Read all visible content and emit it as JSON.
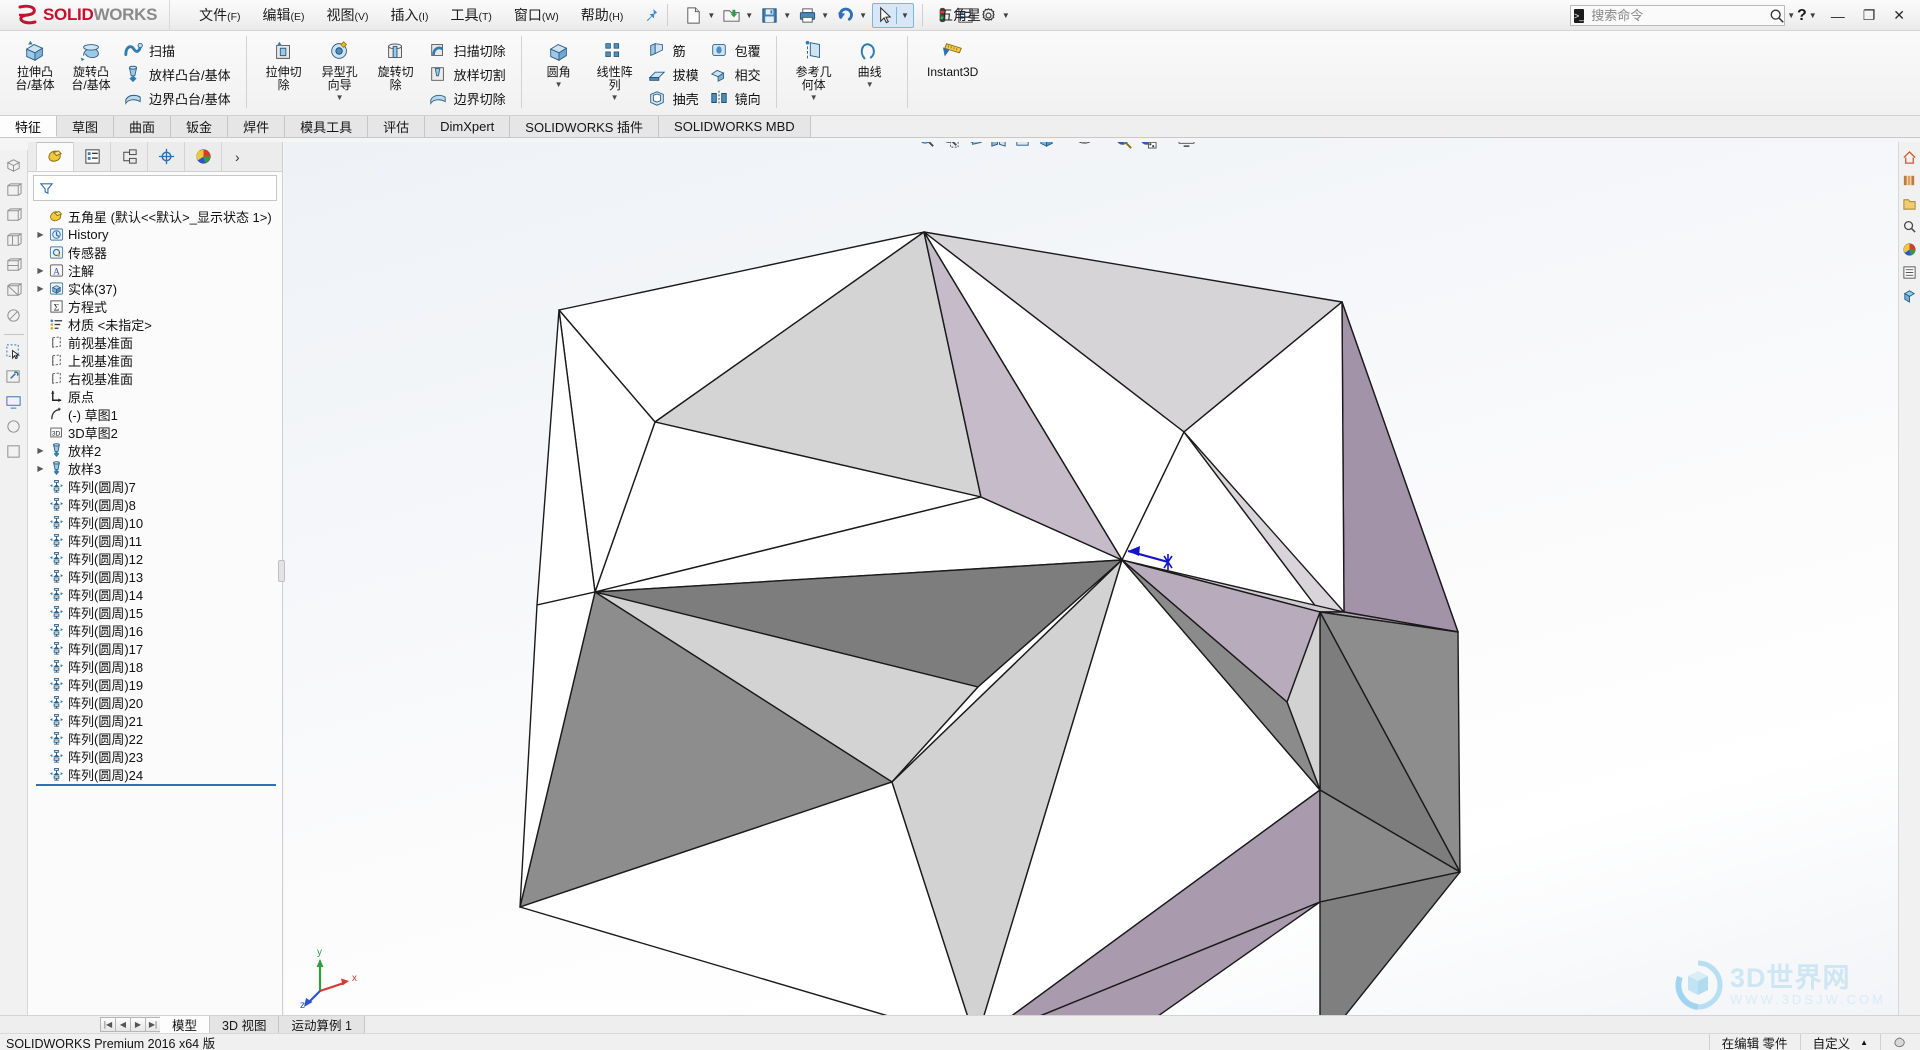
{
  "titlebar": {
    "brand_ds": "2S",
    "brand_solid": "SOLID",
    "brand_works": "WORKS",
    "document_title": "五角星",
    "menus": [
      {
        "label": "文件",
        "mnemonic": "(F)"
      },
      {
        "label": "编辑",
        "mnemonic": "(E)"
      },
      {
        "label": "视图",
        "mnemonic": "(V)"
      },
      {
        "label": "插入",
        "mnemonic": "(I)"
      },
      {
        "label": "工具",
        "mnemonic": "(T)"
      },
      {
        "label": "窗口",
        "mnemonic": "(W)"
      },
      {
        "label": "帮助",
        "mnemonic": "(H)"
      }
    ],
    "pin_icon": "pushpin-icon",
    "quick_tools": [
      {
        "name": "new-document-button",
        "icon": "new-file-icon",
        "has_caret": true
      },
      {
        "name": "open-document-button",
        "icon": "open-folder-icon",
        "has_caret": true
      },
      {
        "name": "save-button",
        "icon": "floppy-disk-icon",
        "has_caret": true
      },
      {
        "name": "print-button",
        "icon": "printer-icon",
        "has_caret": true
      },
      {
        "name": "undo-button",
        "icon": "undo-arrow-icon",
        "has_caret": true
      },
      {
        "name": "select-button",
        "icon": "cursor-arrow-icon",
        "has_caret": true,
        "selected": true
      },
      {
        "name": "rebuild-button",
        "icon": "traffic-light-icon",
        "has_caret": false
      },
      {
        "name": "options-list-button",
        "icon": "list-options-icon",
        "has_caret": false
      },
      {
        "name": "settings-button",
        "icon": "gear-icon",
        "has_caret": true
      }
    ],
    "search": {
      "placeholder": "搜索命令",
      "value": "",
      "icon": "command-search-icon",
      "magnifier": "magnifier-icon"
    },
    "help_label": "?",
    "window_buttons": [
      {
        "name": "minimize-button",
        "glyph": "—"
      },
      {
        "name": "restore-button",
        "glyph": "❐"
      },
      {
        "name": "close-button",
        "glyph": "✕"
      }
    ]
  },
  "ribbon": {
    "groups": [
      {
        "name": "boss-base-group",
        "big": [
          {
            "label": "拉伸凸\n台/基体",
            "icon": "extrude-boss-icon"
          },
          {
            "label": "旋转凸\n台/基体",
            "icon": "revolve-boss-icon"
          }
        ],
        "small": [
          {
            "label": "扫描",
            "icon": "sweep-icon"
          },
          {
            "label": "放样凸台/基体",
            "icon": "loft-boss-icon"
          },
          {
            "label": "边界凸台/基体",
            "icon": "boundary-boss-icon"
          }
        ]
      },
      {
        "name": "cut-group",
        "big": [
          {
            "label": "拉伸切\n除",
            "icon": "extrude-cut-icon"
          },
          {
            "label": "异型孔\n向导",
            "icon": "hole-wizard-icon",
            "caret": true
          },
          {
            "label": "旋转切\n除",
            "icon": "revolve-cut-icon"
          }
        ],
        "small": [
          {
            "label": "扫描切除",
            "icon": "sweep-cut-icon"
          },
          {
            "label": "放样切割",
            "icon": "loft-cut-icon"
          },
          {
            "label": "边界切除",
            "icon": "boundary-cut-icon"
          }
        ]
      },
      {
        "name": "feature-group",
        "big": [
          {
            "label": "圆角",
            "icon": "fillet-icon",
            "caret": true
          },
          {
            "label": "线性阵\n列",
            "icon": "linear-pattern-icon",
            "caret": true
          }
        ],
        "small_a": [
          {
            "label": "筋",
            "icon": "rib-icon"
          },
          {
            "label": "拔模",
            "icon": "draft-icon"
          },
          {
            "label": "抽壳",
            "icon": "shell-icon"
          }
        ],
        "small_b": [
          {
            "label": "包覆",
            "icon": "wrap-icon"
          },
          {
            "label": "相交",
            "icon": "intersect-icon"
          },
          {
            "label": "镜向",
            "icon": "mirror-icon"
          }
        ]
      },
      {
        "name": "reference-group",
        "big": [
          {
            "label": "参考几\n何体",
            "icon": "reference-geometry-icon",
            "caret": true
          },
          {
            "label": "曲线",
            "icon": "curves-icon",
            "caret": true
          }
        ]
      },
      {
        "name": "instant3d-group",
        "big": [
          {
            "label": "Instant3D",
            "icon": "instant3d-icon"
          }
        ]
      }
    ]
  },
  "command_tabs": [
    {
      "label": "特征",
      "active": true
    },
    {
      "label": "草图",
      "active": false
    },
    {
      "label": "曲面",
      "active": false
    },
    {
      "label": "钣金",
      "active": false
    },
    {
      "label": "焊件",
      "active": false
    },
    {
      "label": "模具工具",
      "active": false
    },
    {
      "label": "评估",
      "active": false
    },
    {
      "label": "DimXpert",
      "active": false
    },
    {
      "label": "SOLIDWORKS 插件",
      "active": false
    },
    {
      "label": "SOLIDWORKS MBD",
      "active": false
    }
  ],
  "left_rail": [
    {
      "name": "rail-icon-1",
      "icon": "isometric-view-icon"
    },
    {
      "name": "rail-icon-2",
      "icon": "box-view-icon"
    },
    {
      "name": "rail-icon-3",
      "icon": "box-outline-icon"
    },
    {
      "name": "rail-icon-4",
      "icon": "box-front-icon"
    },
    {
      "name": "rail-icon-5",
      "icon": "box-side-icon"
    },
    {
      "name": "rail-icon-6",
      "icon": "box-top-icon"
    },
    {
      "name": "rail-icon-7",
      "icon": "box-section-icon"
    },
    {
      "name": "rail-icon-8",
      "icon": "new-sketch-cursor-icon"
    },
    {
      "name": "rail-icon-9",
      "icon": "wrench-sketch-icon"
    },
    {
      "name": "rail-icon-10",
      "icon": "display-monitor-icon"
    },
    {
      "name": "rail-icon-11",
      "icon": "appearance-icon"
    },
    {
      "name": "rail-icon-12",
      "icon": "scene-icon"
    }
  ],
  "feature_manager": {
    "tabs": [
      {
        "name": "feature-tree-tab",
        "icon": "feature-tree-icon",
        "active": true
      },
      {
        "name": "property-manager-tab",
        "icon": "property-list-icon",
        "active": false
      },
      {
        "name": "configuration-manager-tab",
        "icon": "configuration-icon",
        "active": false
      },
      {
        "name": "dimxpert-manager-tab",
        "icon": "dimxpert-target-icon",
        "active": false
      },
      {
        "name": "display-manager-tab",
        "icon": "display-sphere-icon",
        "active": false
      }
    ],
    "more_glyph": "›",
    "filter": {
      "icon": "filter-funnel-icon",
      "placeholder": "",
      "value": ""
    },
    "root": {
      "label": "五角星  (默认<<默认>_显示状态 1>)",
      "icon": "part-document-icon"
    },
    "items": [
      {
        "label": "History",
        "icon": "history-icon",
        "arrow": true,
        "indent": 1
      },
      {
        "label": "传感器",
        "icon": "sensor-icon",
        "arrow": false,
        "indent": 1
      },
      {
        "label": "注解",
        "icon": "annotations-icon",
        "arrow": true,
        "indent": 1
      },
      {
        "label": "实体(37)",
        "icon": "solid-bodies-icon",
        "arrow": true,
        "indent": 1
      },
      {
        "label": "方程式",
        "icon": "equations-icon",
        "arrow": false,
        "indent": 1
      },
      {
        "label": "材质 <未指定>",
        "icon": "material-icon",
        "arrow": false,
        "indent": 1
      },
      {
        "label": "前视基准面",
        "icon": "plane-icon",
        "arrow": false,
        "indent": 1
      },
      {
        "label": "上视基准面",
        "icon": "plane-icon",
        "arrow": false,
        "indent": 1
      },
      {
        "label": "右视基准面",
        "icon": "plane-icon",
        "arrow": false,
        "indent": 1
      },
      {
        "label": "原点",
        "icon": "origin-icon",
        "arrow": false,
        "indent": 1
      },
      {
        "label": "(-) 草图1",
        "icon": "sketch-icon",
        "arrow": false,
        "indent": 1
      },
      {
        "label": "3D草图2",
        "icon": "sketch3d-icon",
        "arrow": false,
        "indent": 1
      },
      {
        "label": "放样2",
        "icon": "loft-feature-icon",
        "arrow": true,
        "indent": 1
      },
      {
        "label": "放样3",
        "icon": "loft-feature-icon",
        "arrow": true,
        "indent": 1
      },
      {
        "label": "阵列(圆周)7",
        "icon": "circular-pattern-icon",
        "arrow": false,
        "indent": 1
      },
      {
        "label": "阵列(圆周)8",
        "icon": "circular-pattern-icon",
        "arrow": false,
        "indent": 1
      },
      {
        "label": "阵列(圆周)10",
        "icon": "circular-pattern-icon",
        "arrow": false,
        "indent": 1
      },
      {
        "label": "阵列(圆周)11",
        "icon": "circular-pattern-icon",
        "arrow": false,
        "indent": 1
      },
      {
        "label": "阵列(圆周)12",
        "icon": "circular-pattern-icon",
        "arrow": false,
        "indent": 1
      },
      {
        "label": "阵列(圆周)13",
        "icon": "circular-pattern-icon",
        "arrow": false,
        "indent": 1
      },
      {
        "label": "阵列(圆周)14",
        "icon": "circular-pattern-icon",
        "arrow": false,
        "indent": 1
      },
      {
        "label": "阵列(圆周)15",
        "icon": "circular-pattern-icon",
        "arrow": false,
        "indent": 1
      },
      {
        "label": "阵列(圆周)16",
        "icon": "circular-pattern-icon",
        "arrow": false,
        "indent": 1
      },
      {
        "label": "阵列(圆周)17",
        "icon": "circular-pattern-icon",
        "arrow": false,
        "indent": 1
      },
      {
        "label": "阵列(圆周)18",
        "icon": "circular-pattern-icon",
        "arrow": false,
        "indent": 1
      },
      {
        "label": "阵列(圆周)19",
        "icon": "circular-pattern-icon",
        "arrow": false,
        "indent": 1
      },
      {
        "label": "阵列(圆周)20",
        "icon": "circular-pattern-icon",
        "arrow": false,
        "indent": 1
      },
      {
        "label": "阵列(圆周)21",
        "icon": "circular-pattern-icon",
        "arrow": false,
        "indent": 1
      },
      {
        "label": "阵列(圆周)22",
        "icon": "circular-pattern-icon",
        "arrow": false,
        "indent": 1
      },
      {
        "label": "阵列(圆周)23",
        "icon": "circular-pattern-icon",
        "arrow": false,
        "indent": 1
      },
      {
        "label": "阵列(圆周)24",
        "icon": "circular-pattern-icon",
        "arrow": false,
        "indent": 1
      }
    ]
  },
  "view_toolbar": [
    {
      "name": "zoom-to-fit-button",
      "icon": "zoom-fit-icon"
    },
    {
      "name": "zoom-to-area-button",
      "icon": "zoom-area-icon"
    },
    {
      "name": "previous-view-button",
      "icon": "previous-view-icon"
    },
    {
      "name": "section-view-button",
      "icon": "section-view-icon"
    },
    {
      "name": "view-orientation-button",
      "icon": "view-orientation-icon"
    },
    {
      "name": "display-style-button",
      "icon": "display-style-cube-icon",
      "caret": true
    },
    {
      "name": "hide-show-items-button",
      "icon": "hide-show-eye-icon",
      "caret": true
    },
    {
      "name": "edit-appearance-button",
      "icon": "edit-appearance-icon",
      "caret": true
    },
    {
      "name": "apply-scene-button",
      "icon": "apply-scene-icon",
      "caret": true
    },
    {
      "name": "view-settings-button",
      "icon": "view-settings-monitor-icon",
      "caret": true
    }
  ],
  "right_rail": [
    {
      "name": "right-rail-home",
      "icon": "home-icon"
    },
    {
      "name": "right-rail-library",
      "icon": "design-library-icon"
    },
    {
      "name": "right-rail-explorer",
      "icon": "file-explorer-icon"
    },
    {
      "name": "right-rail-search",
      "icon": "search-panel-icon"
    },
    {
      "name": "right-rail-appearances",
      "icon": "appearances-palette-icon"
    },
    {
      "name": "right-rail-views",
      "icon": "custom-properties-icon"
    },
    {
      "name": "right-rail-drawing",
      "icon": "view-palette-icon"
    }
  ],
  "triad": {
    "x_label": "x",
    "y_label": "y",
    "z_label": "z"
  },
  "watermark": {
    "text": "3D世界网",
    "url": "WWW.3DSJW.COM",
    "icon": "cube-watermark-icon"
  },
  "doc_tabs": {
    "nav_buttons": [
      "|◀",
      "◀",
      "▶",
      "▶|"
    ],
    "tabs": [
      {
        "label": "模型",
        "active": true
      },
      {
        "label": "3D 视图",
        "active": false
      },
      {
        "label": "运动算例 1",
        "active": false
      }
    ]
  },
  "statusbar": {
    "left": "SOLIDWORKS Premium 2016 x64 版",
    "editing": "在编辑 零件",
    "custom": "自定义",
    "custom_caret": "▲",
    "right_icon": "sw-status-icon"
  },
  "colors": {
    "brand_red": "#c8102e",
    "brand_gray": "#8a8a8a",
    "accent_blue": "#2f6fb5",
    "tree_select": "#2f6fb5",
    "face_white": "#ffffff",
    "face_light": "#dedede",
    "face_mid": "#c9c9c9",
    "face_dark": "#8f8f8f",
    "face_purple": "#b5a8b8",
    "face_purple_dark": "#a396a8",
    "edge": "#1a1a1a",
    "triad_x": "#d43a2f",
    "triad_y": "#2f9e3f",
    "triad_z": "#2f52d4"
  }
}
